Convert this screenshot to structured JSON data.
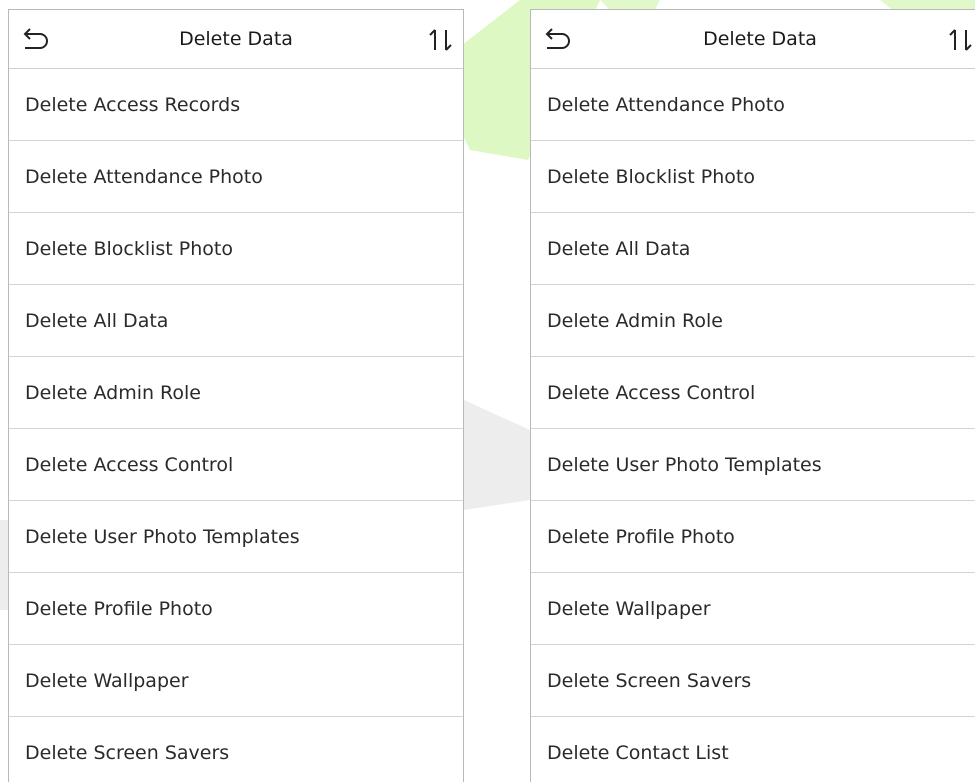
{
  "screens": [
    {
      "header": {
        "title": "Delete Data",
        "back_icon": "back-arrow-icon",
        "sort_icon": "sort-icon"
      },
      "items": [
        "Delete Access Records",
        "Delete Attendance Photo",
        "Delete Blocklist Photo",
        "Delete All Data",
        "Delete Admin Role",
        "Delete Access Control",
        "Delete User Photo Templates",
        "Delete Profile Photo",
        "Delete Wallpaper",
        "Delete Screen Savers"
      ]
    },
    {
      "header": {
        "title": "Delete Data",
        "back_icon": "back-arrow-icon",
        "sort_icon": "sort-icon"
      },
      "items": [
        "Delete Attendance Photo",
        "Delete Blocklist Photo",
        "Delete All Data",
        "Delete Admin Role",
        "Delete Access Control",
        "Delete User Photo Templates",
        "Delete Profile Photo",
        "Delete Wallpaper",
        "Delete Screen Savers",
        "Delete Contact List"
      ]
    }
  ],
  "colors": {
    "watermark_green": "#c8f2a0",
    "watermark_gray": "#ececec",
    "border": "#b9b9b9",
    "text": "#2a2a2a"
  }
}
